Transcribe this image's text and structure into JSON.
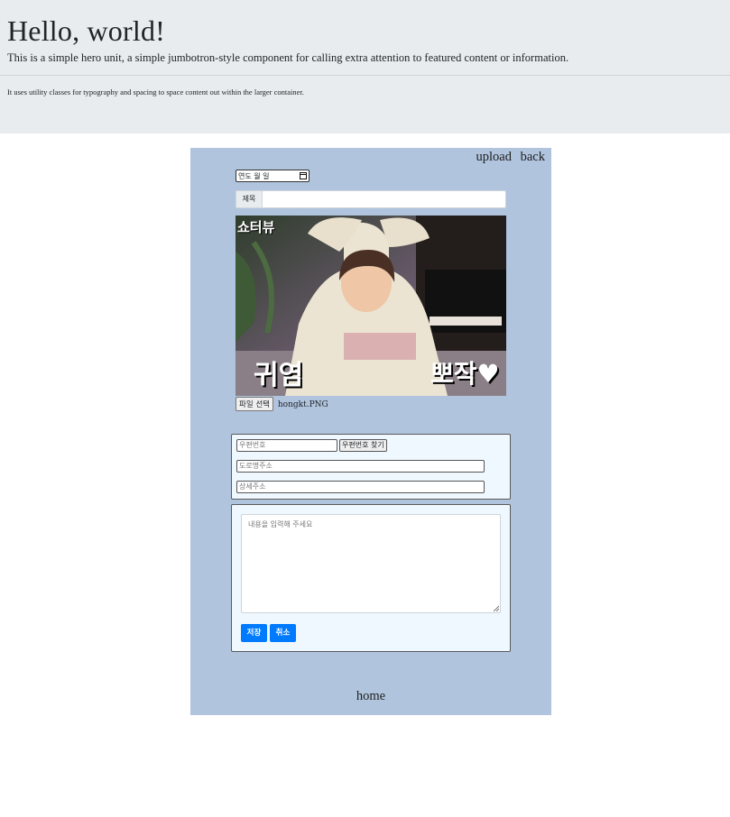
{
  "hero": {
    "title": "Hello, world!",
    "lead": "This is a simple hero unit, a simple jumbotron-style component for calling extra attention to featured content or information.",
    "small": "It uses utility classes for typography and spacing to space content out within the larger container."
  },
  "nav": {
    "upload": "upload",
    "back": "back",
    "home": "home"
  },
  "form": {
    "date_placeholder": "연도 월 일",
    "title_addon": "제목",
    "title_value": "",
    "photo_captions": {
      "top_left": "쇼터뷰",
      "bottom_left": "귀염",
      "bottom_right": "뽀작♥"
    },
    "file_button": "파일 선택",
    "file_name": "hongkt.PNG",
    "zip_placeholder": "우편번호",
    "zip_button": "우편번호 찾기",
    "road_placeholder": "도로명주소",
    "detail_placeholder": "상세주소",
    "content_placeholder": "내용을 입력해 주세요",
    "save_label": "저장",
    "cancel_label": "취소"
  },
  "colors": {
    "hero_bg": "#e9ecef",
    "panel_bg": "#b0c4de",
    "card_bg": "#f0f8ff",
    "primary": "#007bff"
  }
}
